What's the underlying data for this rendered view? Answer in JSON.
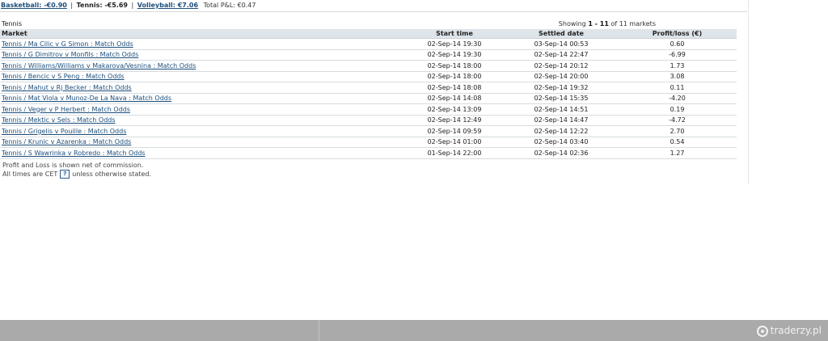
{
  "summary": {
    "basketball_label": "Basketball: -€0.90",
    "tennis_label": "Tennis: -€5.69",
    "volleyball_label": "Volleyball: €7.06",
    "total_label": "Total P&L: €0.47",
    "separator": "|"
  },
  "sport_title": "Tennis",
  "showing": {
    "prefix": "Showing",
    "range": "1 - 11",
    "suffix": "of 11 markets"
  },
  "table": {
    "headers": {
      "market": "Market",
      "start": "Start time",
      "settled": "Settled date",
      "pl": "Profit/loss (€)"
    },
    "rows": [
      {
        "market": "Tennis / Ma Cilic v G Simon : Match Odds",
        "start": "02-Sep-14 19:30",
        "settled": "03-Sep-14 00:53",
        "pl": "0.60"
      },
      {
        "market": "Tennis / G Dimitrov v Monfils : Match Odds",
        "start": "02-Sep-14 19:30",
        "settled": "02-Sep-14 22:47",
        "pl": "-6.99"
      },
      {
        "market": "Tennis / Williams/Williams v Makarova/Vesnina : Match Odds",
        "start": "02-Sep-14 18:00",
        "settled": "02-Sep-14 20:12",
        "pl": "1.73"
      },
      {
        "market": "Tennis / Bencic v S Peng : Match Odds",
        "start": "02-Sep-14 18:00",
        "settled": "02-Sep-14 20:00",
        "pl": "3.08"
      },
      {
        "market": "Tennis / Mahut v Rj Becker : Match Odds",
        "start": "02-Sep-14 18:08",
        "settled": "02-Sep-14 19:32",
        "pl": "0.11"
      },
      {
        "market": "Tennis / Mat Viola v Munoz-De La Nava : Match Odds",
        "start": "02-Sep-14 14:08",
        "settled": "02-Sep-14 15:35",
        "pl": "-4.20"
      },
      {
        "market": "Tennis / Veger v P Herbert : Match Odds",
        "start": "02-Sep-14 13:09",
        "settled": "02-Sep-14 14:51",
        "pl": "0.19"
      },
      {
        "market": "Tennis / Mektic v Sels : Match Odds",
        "start": "02-Sep-14 12:49",
        "settled": "02-Sep-14 14:47",
        "pl": "-4.72"
      },
      {
        "market": "Tennis / Grigelis v Pouille : Match Odds",
        "start": "02-Sep-14 09:59",
        "settled": "02-Sep-14 12:22",
        "pl": "2.70"
      },
      {
        "market": "Tennis / Krunic v Azarenka : Match Odds",
        "start": "02-Sep-14 01:00",
        "settled": "02-Sep-14 03:40",
        "pl": "0.54"
      },
      {
        "market": "Tennis / S Wawrinka v Robredo : Match Odds",
        "start": "01-Sep-14 22:00",
        "settled": "02-Sep-14 02:36",
        "pl": "1.27"
      }
    ]
  },
  "notes": {
    "line1": "Profit and Loss is shown net of commission.",
    "line2_prefix": "All times are CET",
    "help_label": "?",
    "line2_suffix": "unless otherwise stated."
  },
  "watermark": {
    "text": "traderzy.pl",
    "icon": "traderzy-logo-icon"
  }
}
